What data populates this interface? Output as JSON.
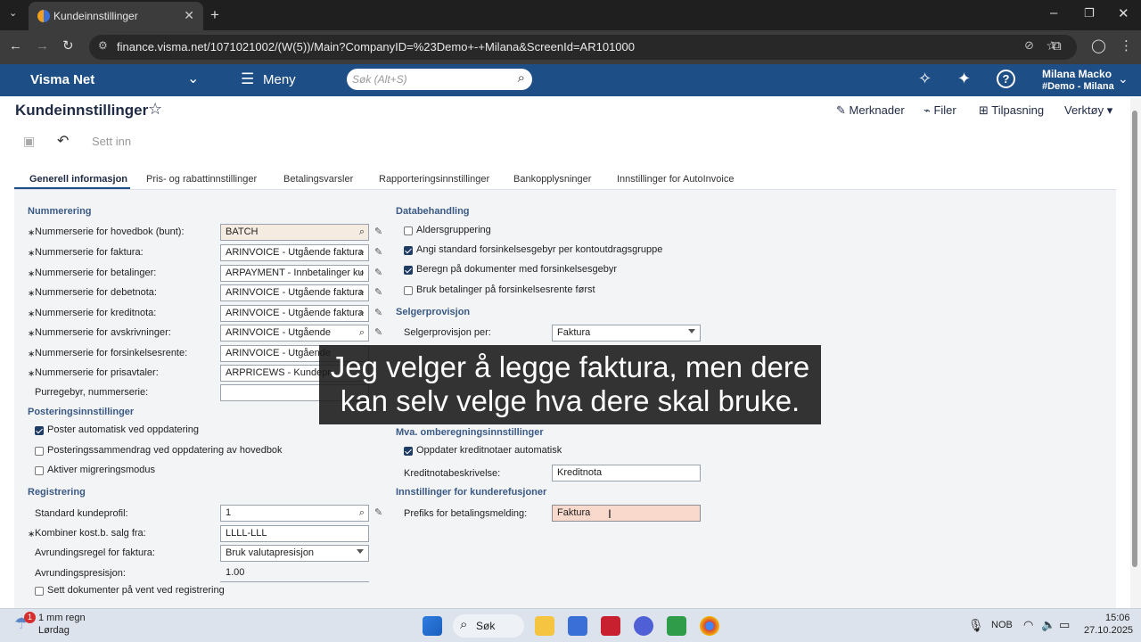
{
  "browser": {
    "tab_title": "Kundeinnstillinger",
    "url": "finance.visma.net/1071021002/(W(5))/Main?CompanyID=%23Demo+-+Milana&ScreenId=AR101000"
  },
  "app": {
    "brand": "Visma Net",
    "menu_label": "Meny",
    "search_placeholder": "Søk (Alt+S)",
    "user_name": "Milana Macko",
    "company": "#Demo - Milana"
  },
  "page": {
    "title": "Kundeinnstillinger",
    "links": [
      "Merknader",
      "Filer",
      "Tilpasning",
      "Verktøy"
    ],
    "toolbar_insert": "Sett inn",
    "tabs": [
      "Generell informasjon",
      "Pris- og rabattinnstillinger",
      "Betalingsvarsler",
      "Rapporteringsinnstillinger",
      "Bankopplysninger",
      "Innstillinger for AutoInvoice"
    ]
  },
  "left": {
    "numbering_title": "Nummerering",
    "numbering": [
      {
        "label": "Nummerserie for hovedbok (bunt):",
        "value": "BATCH"
      },
      {
        "label": "Nummerserie for faktura:",
        "value": "ARINVOICE - Utgående faktura"
      },
      {
        "label": "Nummerserie for betalinger:",
        "value": "ARPAYMENT - Innbetalinger ku"
      },
      {
        "label": "Nummerserie for debetnota:",
        "value": "ARINVOICE - Utgående faktura"
      },
      {
        "label": "Nummerserie for kreditnota:",
        "value": "ARINVOICE - Utgående faktura"
      },
      {
        "label": "Nummerserie for avskrivninger:",
        "value": "ARINVOICE - Utgående"
      },
      {
        "label": "Nummerserie for forsinkelsesrente:",
        "value": "ARINVOICE - Utgående"
      },
      {
        "label": "Nummerserie for prisavtaler:",
        "value": "ARPRICEWS - Kundepr"
      },
      {
        "label": "Purregebyr, nummerserie:",
        "value": ""
      }
    ],
    "posting_title": "Posteringsinnstillinger",
    "posting": [
      {
        "label": "Poster automatisk ved oppdatering",
        "checked": true
      },
      {
        "label": "Posteringssammendrag ved oppdatering av hovedbok",
        "checked": false
      },
      {
        "label": "Aktiver migreringsmodus",
        "checked": false
      }
    ],
    "registration_title": "Registrering",
    "registration": {
      "profile_label": "Standard kundeprofil:",
      "profile_value": "1",
      "combine_label": "Kombiner kost.b. salg fra:",
      "combine_value": "LLLL-LLL",
      "rounding_rule_label": "Avrundingsregel for faktura:",
      "rounding_rule_value": "Bruk valutapresisjon",
      "rounding_precision_label": "Avrundingspresisjon:",
      "rounding_precision_value": "1.00",
      "hold_label": "Sett dokumenter på vent ved registrering"
    }
  },
  "right": {
    "data_title": "Databehandling",
    "data": [
      {
        "label": "Aldersgruppering",
        "checked": false
      },
      {
        "label": "Angi standard forsinkelsesgebyr per kontoutdragsgruppe",
        "checked": true
      },
      {
        "label": "Beregn på dokumenter med forsinkelsesgebyr",
        "checked": true
      },
      {
        "label": "Bruk betalinger på forsinkelsesrente først",
        "checked": false
      }
    ],
    "commission_title": "Selgerprovisjon",
    "commission_label": "Selgerprovisjon per:",
    "commission_value": "Faktura",
    "vat_title": "Mva. omberegningsinnstillinger",
    "vat_check": "Oppdater kreditnotaer automatisk",
    "credit_desc_label": "Kreditnotabeskrivelse:",
    "credit_desc_value": "Kreditnota",
    "refund_title": "Innstillinger for kunderefusjoner",
    "prefix_label": "Prefiks for betalingsmelding:",
    "prefix_value": "Faktura"
  },
  "subtitle": "Jeg velger å legge faktura, men dere kan selv velge hva dere skal bruke.",
  "taskbar": {
    "weather_badge": "1",
    "weather": "1 mm regn",
    "day": "Lørdag",
    "search": "Søk",
    "lang": "NOB",
    "time": "15:06",
    "date": "27.10.2025"
  }
}
